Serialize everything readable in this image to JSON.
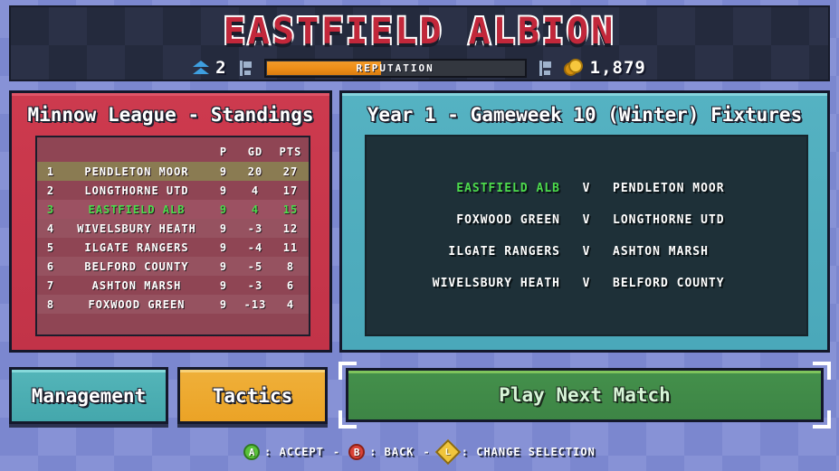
{
  "header": {
    "club_title": "EASTFIELD ALBION",
    "level_icon": "chevron-up-icon",
    "level_value": "2",
    "flag_icon": "flag-icon",
    "reputation_label": "REPUTATION",
    "reputation_percent": 45,
    "reputation_end_icon": "flag-small-icon",
    "coin_icon": "coin-icon",
    "money": "1,879"
  },
  "standings": {
    "title": "Minnow League - Standings",
    "columns": [
      "",
      "",
      "P",
      "GD",
      "PTS"
    ],
    "header_p": "P",
    "header_gd": "GD",
    "header_pts": "PTS",
    "rows": [
      {
        "pos": "1",
        "team": "PENDLETON MOOR",
        "p": "9",
        "gd": "20",
        "pts": "27",
        "style": "leader"
      },
      {
        "pos": "2",
        "team": "LONGTHORNE UTD",
        "p": "9",
        "gd": "4",
        "pts": "17",
        "style": "plain"
      },
      {
        "pos": "3",
        "team": "EASTFIELD ALB",
        "p": "9",
        "gd": "4",
        "pts": "15",
        "style": "mine"
      },
      {
        "pos": "4",
        "team": "WIVELSBURY HEATH",
        "p": "9",
        "gd": "-3",
        "pts": "12",
        "style": "stripe"
      },
      {
        "pos": "5",
        "team": "ILGATE RANGERS",
        "p": "9",
        "gd": "-4",
        "pts": "11",
        "style": "plain"
      },
      {
        "pos": "6",
        "team": "BELFORD COUNTY",
        "p": "9",
        "gd": "-5",
        "pts": "8",
        "style": "stripe"
      },
      {
        "pos": "7",
        "team": "ASHTON MARSH",
        "p": "9",
        "gd": "-3",
        "pts": "6",
        "style": "plain"
      },
      {
        "pos": "8",
        "team": "FOXWOOD GREEN",
        "p": "9",
        "gd": "-13",
        "pts": "4",
        "style": "stripe"
      }
    ]
  },
  "fixtures": {
    "title": "Year 1 - Gameweek 10 (Winter) Fixtures",
    "versus_label": "V",
    "rows": [
      {
        "home": "EASTFIELD ALB",
        "v": "V",
        "away": "PENDLETON MOOR",
        "mine": true
      },
      {
        "home": "FOXWOOD GREEN",
        "v": "V",
        "away": "LONGTHORNE UTD",
        "mine": false
      },
      {
        "home": "ILGATE RANGERS",
        "v": "V",
        "away": "ASHTON MARSH",
        "mine": false
      },
      {
        "home": "WIVELSBURY HEATH",
        "v": "V",
        "away": "BELFORD COUNTY",
        "mine": false
      }
    ]
  },
  "buttons": {
    "management": "Management",
    "tactics": "Tactics",
    "play_next_match": "Play Next Match",
    "selected": "play_next_match"
  },
  "footer": {
    "accept_button": "A",
    "accept_label": ": ACCEPT",
    "sep1": "-",
    "back_button": "B",
    "back_label": ": BACK",
    "sep2": "-",
    "dpad_button": "L",
    "dpad_label": ": CHANGE SELECTION"
  },
  "colors": {
    "background": "#8792d6",
    "header_panel": "#242a3d",
    "title_red": "#c2273a",
    "standings_red": "#c23348",
    "fixtures_teal": "#4aa8ba",
    "management_teal": "#44a7ac",
    "tactics_orange": "#eba326",
    "play_green": "#3d8545",
    "my_team_green": "#4ddb4d",
    "reputation_orange": "#ef8f18",
    "coin_gold": "#f7c73d"
  }
}
